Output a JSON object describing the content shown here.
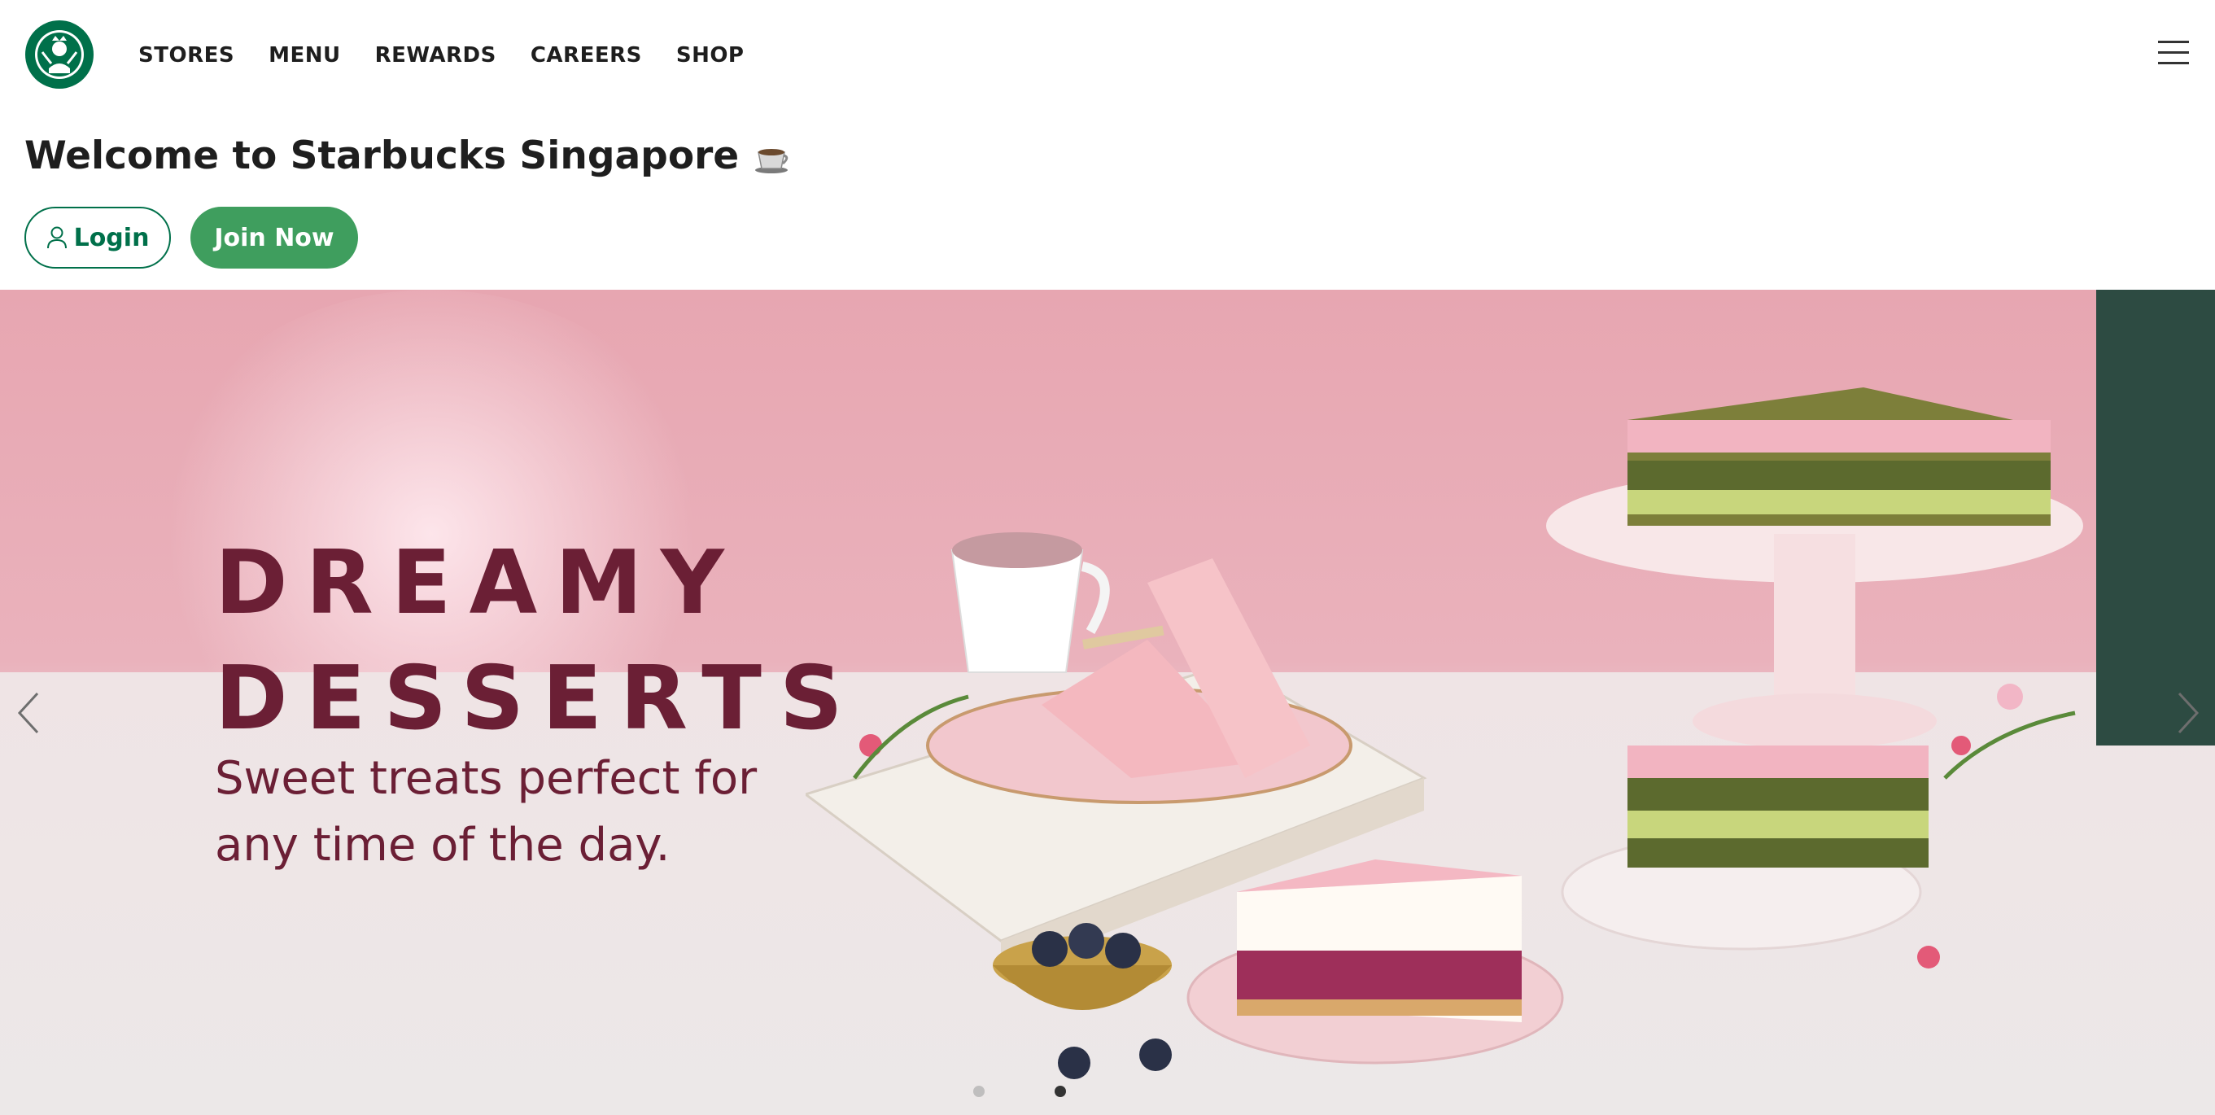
{
  "header": {
    "logo_alt": "Starbucks",
    "nav": [
      {
        "label": "STORES"
      },
      {
        "label": "MENU"
      },
      {
        "label": "REWARDS"
      },
      {
        "label": "CAREERS"
      },
      {
        "label": "SHOP"
      }
    ],
    "menu_icon": "hamburger-icon"
  },
  "welcome": {
    "title": "Welcome to Starbucks Singapore",
    "title_icon": "coffee-cup-icon",
    "login_label": "Login",
    "login_icon": "person-icon",
    "join_label": "Join Now"
  },
  "hero": {
    "headline": "DREAMY\nDESSERTS",
    "subtitle": "Sweet treats perfect for\nany time of the day.",
    "prev_icon": "chevron-left-icon",
    "next_icon": "chevron-right-icon",
    "slides_count": 2,
    "active_slide": 2
  },
  "colors": {
    "brand_green": "#00704a",
    "join_button": "#3f9e5e",
    "headline": "#6b1f35",
    "hero_pink": "#e7a6b1"
  }
}
